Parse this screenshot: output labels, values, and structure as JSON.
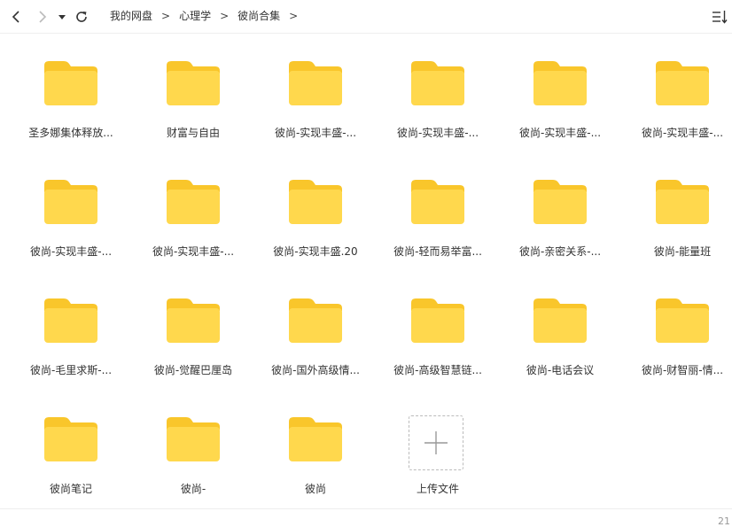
{
  "breadcrumb": [
    "我的网盘",
    "心理学",
    "彼尚合集"
  ],
  "breadcrumb_separator": ">",
  "items": [
    {
      "label": "圣多娜集体释放..."
    },
    {
      "label": "财富与自由"
    },
    {
      "label": "彼尚-实现丰盛-..."
    },
    {
      "label": "彼尚-实现丰盛-..."
    },
    {
      "label": "彼尚-实现丰盛-..."
    },
    {
      "label": "彼尚-实现丰盛-..."
    },
    {
      "label": "彼尚-实现丰盛-..."
    },
    {
      "label": "彼尚-实现丰盛-..."
    },
    {
      "label": "彼尚-实现丰盛.20"
    },
    {
      "label": "彼尚-轻而易举富..."
    },
    {
      "label": "彼尚-亲密关系-..."
    },
    {
      "label": "彼尚-能量班"
    },
    {
      "label": "彼尚-毛里求斯-..."
    },
    {
      "label": "彼尚-觉醒巴厘岛"
    },
    {
      "label": "彼尚-国外高级情..."
    },
    {
      "label": "彼尚-高级智慧链..."
    },
    {
      "label": "彼尚-电话会议"
    },
    {
      "label": "彼尚-财智丽-情..."
    },
    {
      "label": "彼尚笔记"
    },
    {
      "label": "彼尚-"
    },
    {
      "label": "彼尚"
    }
  ],
  "upload": {
    "label": "上传文件"
  },
  "footer": {
    "count": "21"
  },
  "colors": {
    "folder_front": "#FFD84D",
    "folder_back": "#F9C62B",
    "accent": "#333333"
  }
}
